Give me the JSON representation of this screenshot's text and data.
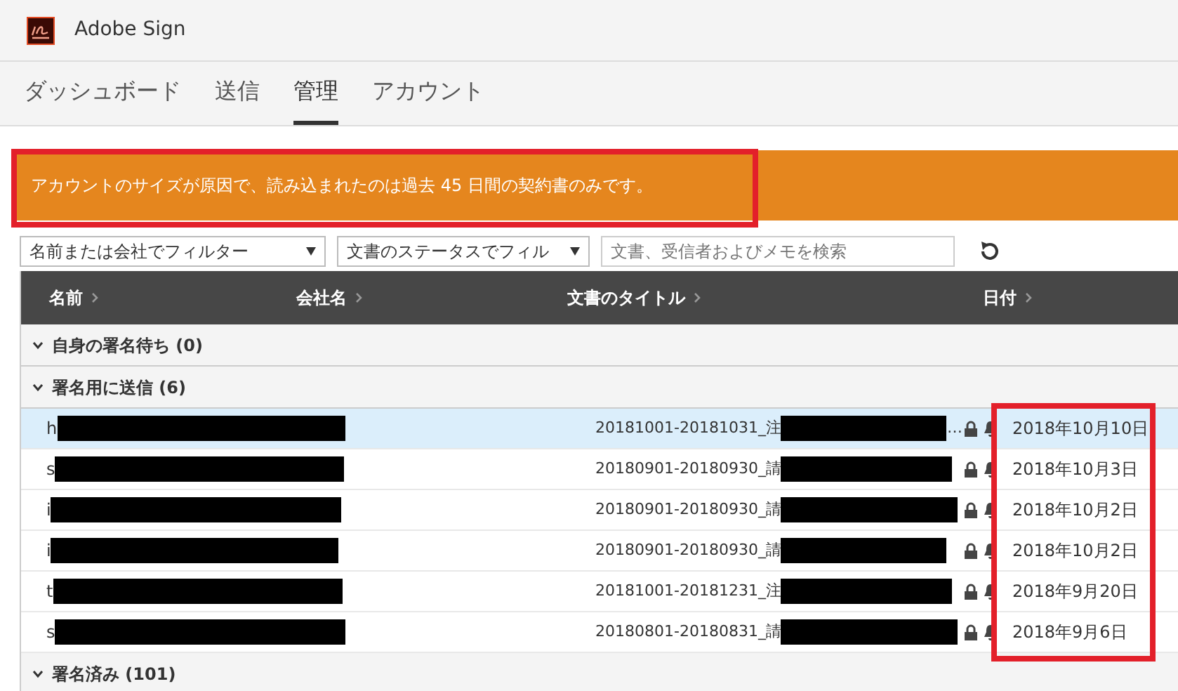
{
  "app": {
    "title": "Adobe Sign"
  },
  "tabs": [
    {
      "label": "ダッシュボード",
      "selected": false
    },
    {
      "label": "送信",
      "selected": false
    },
    {
      "label": "管理",
      "selected": true
    },
    {
      "label": "アカウント",
      "selected": false
    }
  ],
  "banner": {
    "text": "アカウントのサイズが原因で、読み込まれたのは過去 45 日間の契約書のみです。",
    "outlined": true
  },
  "filters": [
    {
      "value": "名前または会社でフィルター"
    },
    {
      "value": "文書のステータスでフィル"
    }
  ],
  "search": {
    "placeholder": "文書、受信者およびメモを検索"
  },
  "table": {
    "columns": [
      "名前",
      "会社名",
      "文書のタイトル",
      "日付"
    ],
    "date_column_outlined": true,
    "groups": [
      {
        "label": "自身の署名待ち (0)",
        "expanded": true
      },
      {
        "label": "署名用に送信 (6)",
        "expanded": true,
        "rows": [
          {
            "name": "h",
            "title": "20181001-20181031_注",
            "title_tail": "…",
            "date": "2018年10月10日",
            "selected": true
          },
          {
            "name": "s",
            "title": "20180901-20180930_請",
            "date": "2018年10月3日",
            "selected": false
          },
          {
            "name": "i",
            "title": "20180901-20180930_請",
            "date": "2018年10月2日",
            "selected": false
          },
          {
            "name": "i",
            "title": "20180901-20180930_請",
            "date": "2018年10月2日",
            "selected": false
          },
          {
            "name": "t",
            "title": "20181001-20181231_注",
            "date": "2018年9月20日",
            "selected": false
          },
          {
            "name": "s",
            "title": "20180801-20180831_請",
            "date": "2018年9月6日",
            "selected": false
          }
        ]
      },
      {
        "label": "署名済み (101)",
        "expanded": true
      }
    ]
  }
}
